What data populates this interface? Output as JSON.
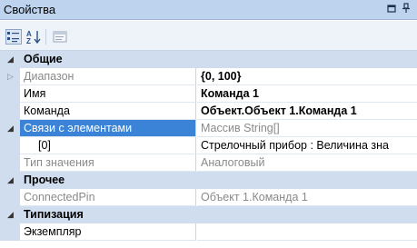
{
  "window": {
    "title": "Свойства",
    "buttons": {
      "dock": "▫",
      "pin": "⊥"
    }
  },
  "toolbar": {
    "buttons": [
      {
        "name": "categorized-view-button",
        "icon": "categorized-icon"
      },
      {
        "name": "alphabetical-view-button",
        "icon": "sort-az-icon"
      },
      {
        "name": "property-pages-button",
        "icon": "property-pages-icon"
      }
    ]
  },
  "categories": [
    {
      "label": "Общие",
      "properties": [
        {
          "name": "Диапазон",
          "value": "{0, 100}",
          "name_muted": true,
          "value_bold": true,
          "expander": "▷"
        },
        {
          "name": "Имя",
          "value": "Команда 1",
          "value_bold": true
        },
        {
          "name": "Команда",
          "value": "Объект.Объект 1.Команда 1",
          "value_bold": true
        },
        {
          "name": "Связи с элементами",
          "value": "Массив String[]",
          "selected": true,
          "value_muted": true,
          "expander": "◢"
        },
        {
          "name": "[0]",
          "value": "Стрелочный прибор : Величина зна",
          "indent": true
        },
        {
          "name": "Тип значения",
          "value": "Аналоговый",
          "name_muted": true,
          "value_muted": true
        }
      ]
    },
    {
      "label": "Прочее",
      "properties": [
        {
          "name": "ConnectedPin",
          "value": "Объект 1.Команда 1",
          "name_muted": true,
          "value_muted": true
        }
      ]
    },
    {
      "label": "Типизация",
      "properties": [
        {
          "name": "Экземпляр",
          "value": ""
        }
      ]
    }
  ],
  "colors": {
    "titlebar": "#bdd3ee",
    "category_background": "#cfddef",
    "selection": "#3b83d6",
    "muted_text": "#8a8a8a"
  }
}
